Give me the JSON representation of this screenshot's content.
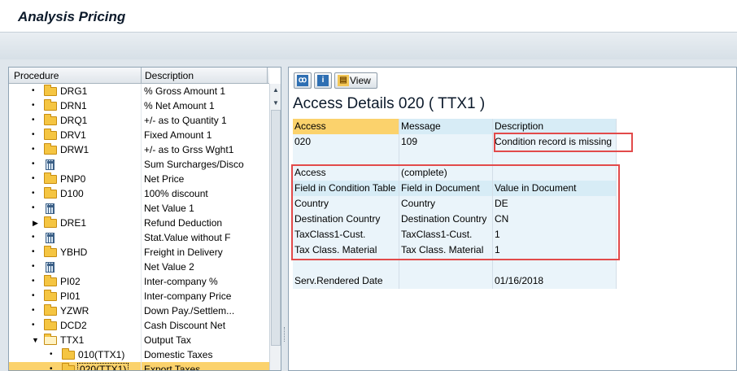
{
  "window": {
    "title": "Analysis Pricing"
  },
  "tree": {
    "columns": [
      "Procedure",
      "Description"
    ],
    "rows": [
      {
        "kind": "folder",
        "marker": "bullet",
        "indent": 0,
        "code": "DRG1",
        "desc": "% Gross Amount 1"
      },
      {
        "kind": "folder",
        "marker": "bullet",
        "indent": 0,
        "code": "DRN1",
        "desc": "% Net Amount 1"
      },
      {
        "kind": "folder",
        "marker": "bullet",
        "indent": 0,
        "code": "DRQ1",
        "desc": "+/- as to Quantity 1"
      },
      {
        "kind": "folder",
        "marker": "bullet",
        "indent": 0,
        "code": "DRV1",
        "desc": "Fixed Amount 1"
      },
      {
        "kind": "folder",
        "marker": "bullet",
        "indent": 0,
        "code": "DRW1",
        "desc": "+/- as to Grss Wght1"
      },
      {
        "kind": "calc",
        "marker": "bullet",
        "indent": 0,
        "code": "",
        "desc": "Sum Surcharges/Disco"
      },
      {
        "kind": "folder",
        "marker": "bullet",
        "indent": 0,
        "code": "PNP0",
        "desc": "Net Price"
      },
      {
        "kind": "folder",
        "marker": "bullet",
        "indent": 0,
        "code": "D100",
        "desc": "100% discount"
      },
      {
        "kind": "calc",
        "marker": "bullet",
        "indent": 0,
        "code": "",
        "desc": "Net Value 1"
      },
      {
        "kind": "folder",
        "marker": "collapsed",
        "indent": 0,
        "code": "DRE1",
        "desc": "Refund Deduction"
      },
      {
        "kind": "calc",
        "marker": "bullet",
        "indent": 0,
        "code": "",
        "desc": "Stat.Value without F"
      },
      {
        "kind": "folder",
        "marker": "bullet",
        "indent": 0,
        "code": "YBHD",
        "desc": "Freight in Delivery"
      },
      {
        "kind": "calc",
        "marker": "bullet",
        "indent": 0,
        "code": "",
        "desc": "Net Value 2"
      },
      {
        "kind": "folder",
        "marker": "bullet",
        "indent": 0,
        "code": "PI02",
        "desc": "Inter-company %"
      },
      {
        "kind": "folder",
        "marker": "bullet",
        "indent": 0,
        "code": "PI01",
        "desc": "Inter-company Price"
      },
      {
        "kind": "folder",
        "marker": "bullet",
        "indent": 0,
        "code": "YZWR",
        "desc": "Down Pay./Settlem..."
      },
      {
        "kind": "folder",
        "marker": "bullet",
        "indent": 0,
        "code": "DCD2",
        "desc": "Cash Discount Net"
      },
      {
        "kind": "folder-open",
        "marker": "expanded",
        "indent": 0,
        "code": "TTX1",
        "desc": "Output Tax"
      },
      {
        "kind": "folder",
        "marker": "bullet",
        "indent": 1,
        "code": "010(TTX1)",
        "desc": "Domestic Taxes"
      },
      {
        "kind": "folder",
        "marker": "bullet",
        "indent": 1,
        "code": "020(TTX1)",
        "desc": "Export Taxes",
        "selected": true
      }
    ]
  },
  "detail": {
    "buttons": {
      "view_label": "View"
    },
    "title": "Access Details 020 ( TTX1 )",
    "header": [
      "Access",
      "Message",
      "Description"
    ],
    "access_row": [
      "020",
      "109",
      "Condition record is missing"
    ],
    "rows": [
      [
        "",
        "",
        ""
      ],
      [
        "Access",
        "(complete)",
        ""
      ],
      [
        "Field in Condition Table",
        "Field in Document",
        "Value in Document"
      ],
      [
        "Country",
        "Country",
        "DE"
      ],
      [
        "Destination Country",
        "Destination Country",
        "CN"
      ],
      [
        "TaxClass1-Cust.",
        "TaxClass1-Cust.",
        "1"
      ],
      [
        "Tax Class. Material",
        "Tax Class. Material",
        "1"
      ],
      [
        "",
        "",
        ""
      ],
      [
        "Serv.Rendered Date",
        "",
        "01/16/2018"
      ]
    ]
  },
  "colors": {
    "highlight": "#e24a4a",
    "selection": "#fbd26c",
    "header_cell": "#d7ecf6"
  }
}
